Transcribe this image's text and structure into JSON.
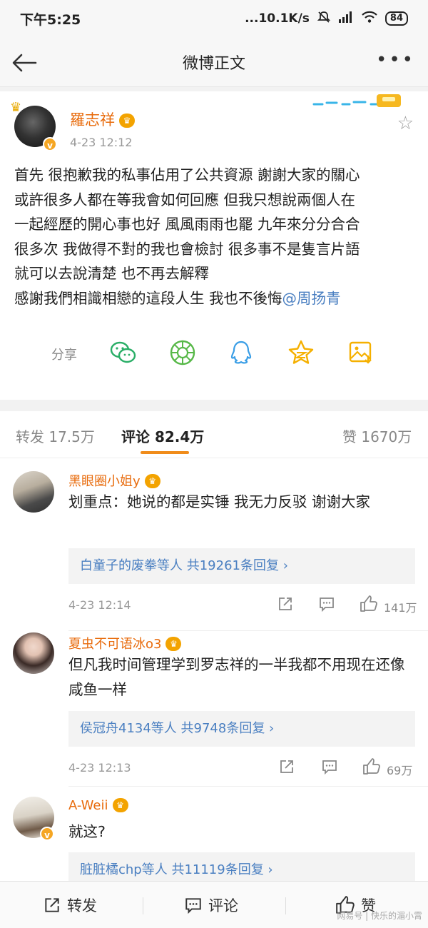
{
  "status_bar": {
    "time": "下午5:25",
    "network_speed": "...10.1K/s",
    "battery": "84"
  },
  "nav": {
    "title": "微博正文"
  },
  "post": {
    "author": "羅志祥",
    "date": "4-23 12:12",
    "lines": [
      "首先 很抱歉我的私事佔用了公共資源 謝謝大家的關心",
      "或許很多人都在等我會如何回應 但我只想說兩個人在",
      "一起經歷的開心事也好 風風雨雨也罷 九年來分分合合",
      "很多次 我做得不對的我也會檢討 很多事不是隻言片語",
      "就可以去說清楚 也不再去解釋",
      "感謝我們相識相戀的這段人生 我也不後悔"
    ],
    "mention": "@周扬青",
    "share_label": "分享"
  },
  "tabs": {
    "repost": "转发 17.5万",
    "comment": "评论 82.4万",
    "like": "赞 1670万"
  },
  "comments": [
    {
      "name": "黑眼圈小姐y",
      "text": "划重点：她说的都是实锤 我无力反驳 谢谢大家",
      "replies": "白童子的废拳等人  共19261条回复 ›",
      "date": "4-23 12:14",
      "likes": "141万"
    },
    {
      "name": "夏虫不可语冰o3",
      "text": "但凡我时间管理学到罗志祥的一半我都不用现在还像咸鱼一样",
      "replies": "侯冠舟4134等人  共9748条回复 ›",
      "date": "4-23 12:13",
      "likes": "69万"
    },
    {
      "name": "A-Weii",
      "text": "就这?",
      "replies": "脏脏橘chp等人  共11119条回复 ›"
    }
  ],
  "bottom_bar": {
    "repost": "转发",
    "comment": "评论",
    "like": "赞"
  },
  "watermark": "网易号 | 快乐的湄小霄",
  "colors": {
    "username": "#e86b0c",
    "link": "#4a7fc1",
    "accent": "#f08c1a",
    "wechat": "#2aae67",
    "moments": "#57b848",
    "qq": "#3a9ee6",
    "qzone": "#f5b000"
  }
}
